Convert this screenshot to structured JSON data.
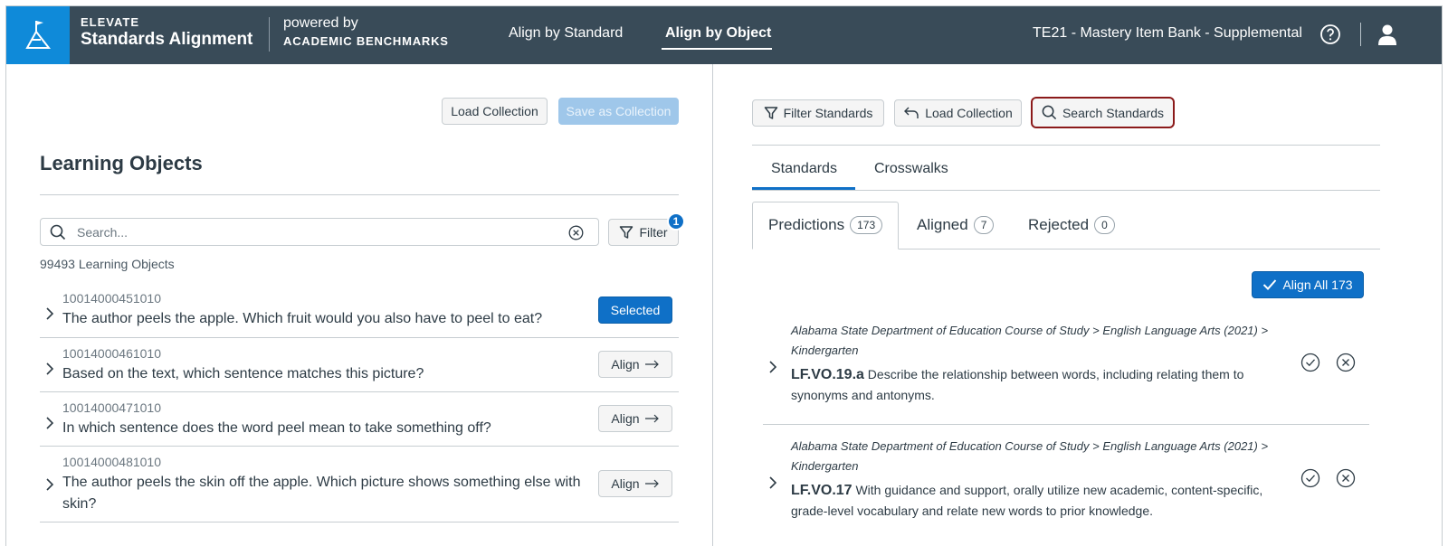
{
  "header": {
    "brand_top": "ELEVATE",
    "brand_bottom": "Standards Alignment",
    "powered_top": "powered by",
    "powered_bottom": "ACADEMIC BENCHMARKS",
    "nav": [
      {
        "label": "Align by Standard"
      },
      {
        "label": "Align by Object"
      }
    ],
    "bank_name": "TE21 - Mastery Item Bank - Supplemental"
  },
  "left": {
    "load_collection": "Load Collection",
    "save_collection": "Save as Collection",
    "title": "Learning Objects",
    "search_placeholder": "Search...",
    "filter_label": "Filter",
    "filter_badge": "1",
    "count_text": "99493 Learning Objects",
    "items": [
      {
        "id": "10014000451010",
        "text": "The author peels the apple. Which fruit would you also have to peel to eat?",
        "action": "Selected"
      },
      {
        "id": "10014000461010",
        "text": "Based on the text, which sentence matches this picture?",
        "action": "Align"
      },
      {
        "id": "10014000471010",
        "text": "In which sentence does the word peel mean to take something off?",
        "action": "Align"
      },
      {
        "id": "10014000481010",
        "text": "The author peels the skin off the apple. Which picture shows something else with skin?",
        "action": "Align"
      }
    ]
  },
  "right": {
    "filter_standards": "Filter Standards",
    "load_collection": "Load Collection",
    "search_standards": "Search Standards",
    "tabs": [
      {
        "label": "Standards"
      },
      {
        "label": "Crosswalks"
      }
    ],
    "subtabs": [
      {
        "label": "Predictions",
        "count": "173"
      },
      {
        "label": "Aligned",
        "count": "7"
      },
      {
        "label": "Rejected",
        "count": "0"
      }
    ],
    "align_all": "Align All 173",
    "standards": [
      {
        "path": "Alabama State Department of Education Course of Study > English Language Arts (2021) > Kindergarten",
        "code": "LF.VO.19.a",
        "description": " Describe the relationship between words, including relating them to synonyms and antonyms."
      },
      {
        "path": "Alabama State Department of Education Course of Study > English Language Arts (2021) > Kindergarten",
        "code": "LF.VO.17",
        "description": " With guidance and support, orally utilize new academic, content-specific, grade-level vocabulary and relate new words to prior knowledge."
      }
    ]
  },
  "colors": {
    "header_bg": "#394b58",
    "brand_blue": "#0f8ad9",
    "primary": "#0f70c7",
    "search_highlight": "#8b1a1a"
  }
}
